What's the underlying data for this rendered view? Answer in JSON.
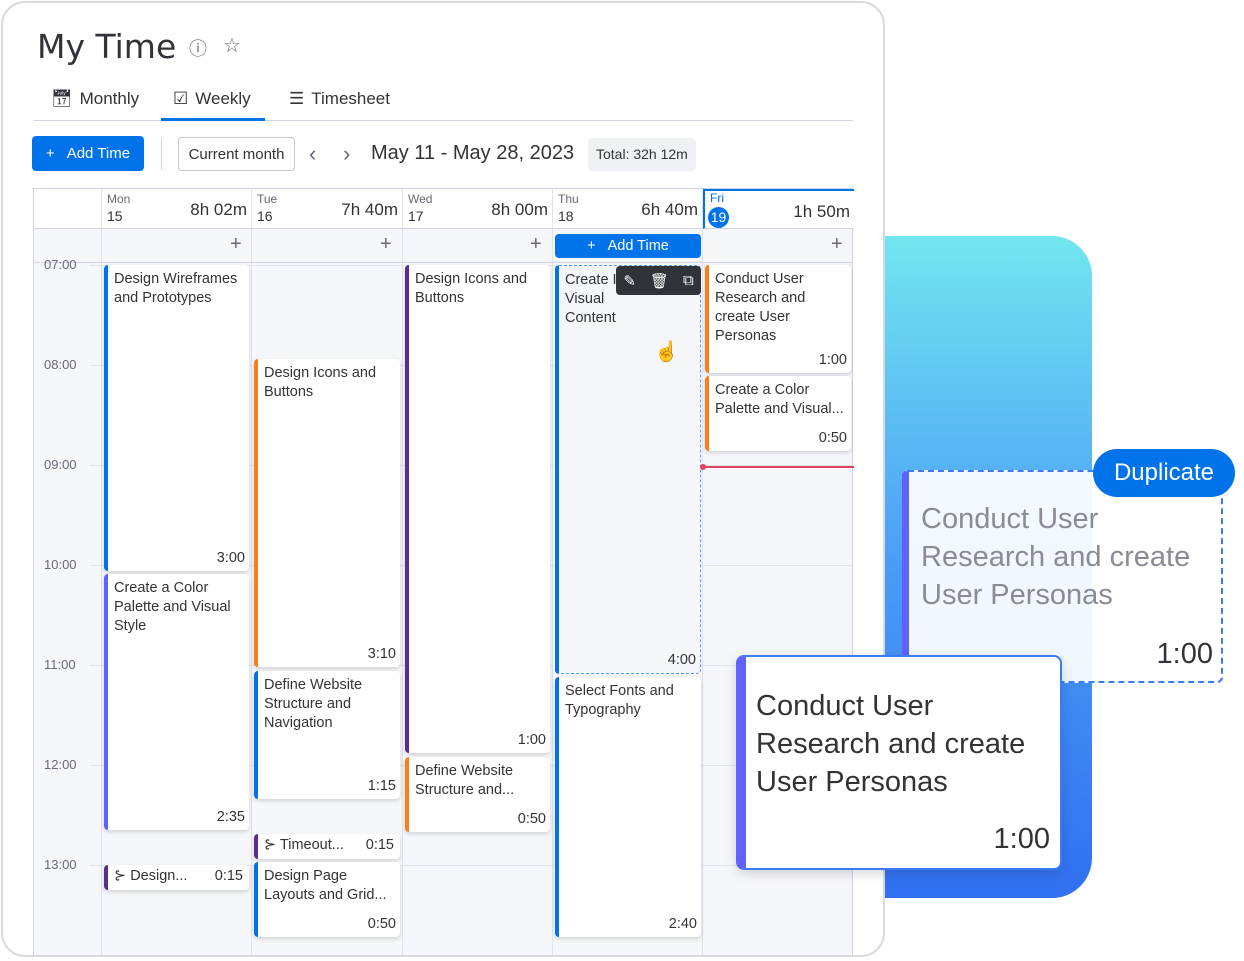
{
  "header": {
    "title": "My Time",
    "info_icon": "info-icon",
    "star_icon": "star-icon"
  },
  "tabs": [
    {
      "label": "Monthly",
      "icon": "calendar-icon"
    },
    {
      "label": "Weekly",
      "icon": "calendar-check-icon",
      "active": true
    },
    {
      "label": "Timesheet",
      "icon": "list-icon"
    }
  ],
  "toolbar": {
    "add_time": "Add Time",
    "current_month": "Current month",
    "date_range": "May 11 - May 28, 2023",
    "total": "Total: 32h 12m"
  },
  "days": [
    {
      "name": "Mon",
      "num": "15",
      "total": "8h 02m"
    },
    {
      "name": "Tue",
      "num": "16",
      "total": "7h 40m"
    },
    {
      "name": "Wed",
      "num": "17",
      "total": "8h 00m"
    },
    {
      "name": "Thu",
      "num": "18",
      "total": "6h 40m"
    },
    {
      "name": "Fri",
      "num": "19",
      "total": "1h 50m",
      "today": true
    }
  ],
  "hours": [
    "07:00",
    "08:00",
    "09:00",
    "10:00",
    "11:00",
    "12:00",
    "13:00"
  ],
  "add_time_cell": "Add Time",
  "entries": {
    "mon": [
      {
        "title": "Design Wireframes and Prototypes",
        "dur": "3:00"
      },
      {
        "title": "Create a Color Palette and Visual Style",
        "dur": "2:35"
      },
      {
        "title": "Design...",
        "dur": "0:15"
      }
    ],
    "tue": [
      {
        "title": "Design Icons and Buttons",
        "dur": "3:10"
      },
      {
        "title": "Define Website Structure and Navigation",
        "dur": "1:15"
      },
      {
        "title": "Timeout...",
        "dur": "0:15"
      },
      {
        "title": "Design Page Layouts and Grid...",
        "dur": "0:50"
      }
    ],
    "wed": [
      {
        "title": "Design Icons and Buttons",
        "dur": "1:00"
      },
      {
        "title": "Define Website Structure and...",
        "dur": "0:50"
      }
    ],
    "thu": [
      {
        "title": "Create I Visual Content",
        "dur": "4:00"
      },
      {
        "title": "Select Fonts and Typography",
        "dur": "2:40"
      }
    ],
    "fri": [
      {
        "title": "Conduct User Research and create User Personas",
        "dur": "1:00"
      },
      {
        "title": "Create a Color Palette and Visual...",
        "dur": "0:50"
      }
    ]
  },
  "overlay": {
    "duplicate_label": "Duplicate",
    "ghost_title": "Conduct User Research and create User Personas",
    "ghost_dur": "1:00",
    "card_title": "Conduct User Research and create User Personas",
    "card_dur": "1:00"
  },
  "colors": {
    "blue": "#0073ea",
    "orange": "#fd7e14",
    "purple": "#5c2d91",
    "indigo": "#6161ff",
    "now": "#e2445c"
  }
}
